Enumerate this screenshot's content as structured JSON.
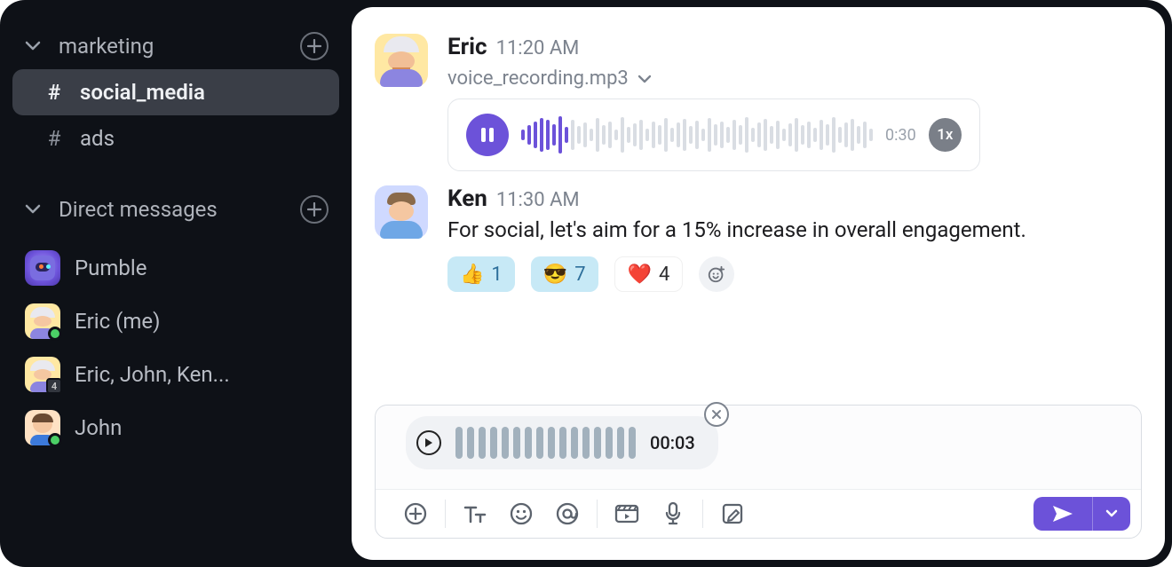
{
  "sidebar": {
    "channels_section": {
      "label": "marketing"
    },
    "channels": [
      {
        "name": "social_media"
      },
      {
        "name": "ads"
      }
    ],
    "dm_section": {
      "label": "Direct messages"
    },
    "dms": [
      {
        "label": "Pumble"
      },
      {
        "label": "Eric (me)"
      },
      {
        "label": "Eric, John, Ken...",
        "count": "4"
      },
      {
        "label": "John"
      }
    ]
  },
  "messages": [
    {
      "author": "Eric",
      "time": "11:20 AM",
      "attachment_name": "voice_recording.mp3",
      "duration": "0:30",
      "speed": "1x"
    },
    {
      "author": "Ken",
      "time": "11:30 AM",
      "text": "For social, let's aim for a 15% increase in overall engagement.",
      "reactions": [
        {
          "emoji": "👍",
          "count": "1"
        },
        {
          "emoji": "😎",
          "count": "7"
        },
        {
          "emoji": "❤️",
          "count": "4"
        }
      ]
    }
  ],
  "composer": {
    "record_time": "00:03"
  }
}
